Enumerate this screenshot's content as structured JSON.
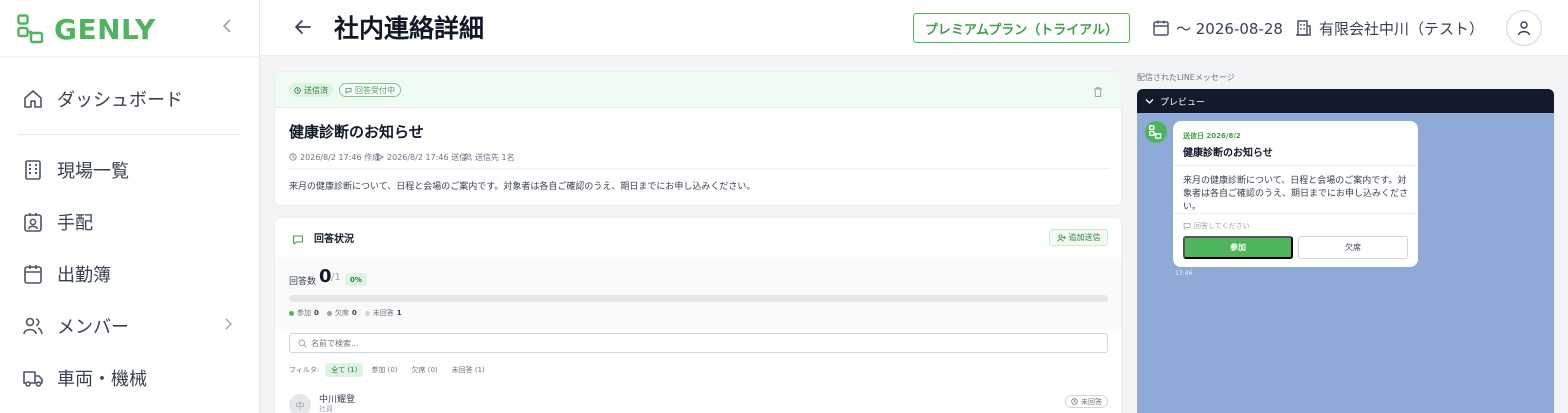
{
  "brand": {
    "name": "GENLY",
    "color": "#4fb55d"
  },
  "sidebar": {
    "items": [
      {
        "label": "ダッシュボード",
        "icon": "home-icon"
      },
      {
        "label": "現場一覧",
        "icon": "building-icon"
      },
      {
        "label": "手配",
        "icon": "badge-icon"
      },
      {
        "label": "出勤簿",
        "icon": "calendar-icon"
      },
      {
        "label": "メンバー",
        "icon": "users-icon"
      },
      {
        "label": "車両・機械",
        "icon": "truck-icon"
      }
    ]
  },
  "header": {
    "title": "社内連絡詳細",
    "plan": "プレミアムプラン（トライアル）",
    "date_range": "〜 2026-08-28",
    "company": "有限会社中川（テスト）"
  },
  "message": {
    "status_sent": "送信済",
    "status_open": "回答受付中",
    "title": "健康診断のお知らせ",
    "created": "2026/8/2 17:46 作成",
    "sent": "2026/8/2 17:46 送信",
    "recipients": "送信先 1名",
    "body": "来月の健康診断について、日程と会場のご案内です。対象者は各自ご確認のうえ、期日までにお申し込みください。"
  },
  "responses": {
    "title": "回答状況",
    "add_send": "追加送信",
    "count_label": "回答数",
    "count": "0",
    "total": "/1",
    "percent": "0%",
    "progress": 0,
    "legend": {
      "join_label": "参加",
      "join_count": "0",
      "absent_label": "欠席",
      "absent_count": "0",
      "none_label": "未回答",
      "none_count": "1"
    },
    "search_placeholder": "名前で検索...",
    "filter_label": "フィルタ:",
    "filters": [
      "全て (1)",
      "参加 (0)",
      "欠席 (0)",
      "未回答 (1)"
    ],
    "rows": [
      {
        "avatar": "中",
        "name": "中川耀登",
        "role": "社員",
        "status": "未回答"
      }
    ]
  },
  "preview": {
    "section_label": "配信されたLINEメッセージ",
    "bar_label": "プレビュー",
    "date": "送信日 2026/8/2",
    "title": "健康診断のお知らせ",
    "body": "来月の健康診断について、日程と会場のご案内です。対象者は各自ご確認のうえ、期日までにお申し込みください。",
    "question": "回答してください",
    "join_button": "参加",
    "absent_button": "欠席",
    "time": "17:46"
  },
  "colors": {
    "accent": "#4fb55d",
    "line_bg": "#8eabd8",
    "dark_bar": "#131a2b"
  }
}
